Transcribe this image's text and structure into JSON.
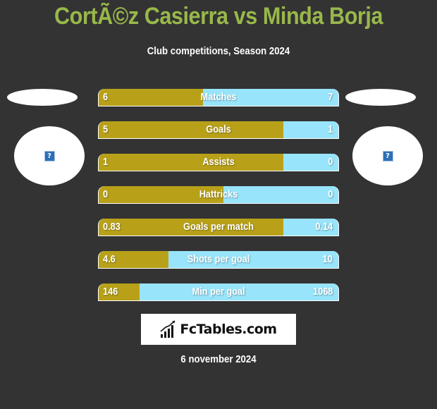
{
  "header": {
    "title": "CortÃ©z Casierra vs Minda Borja",
    "subtitle": "Club competitions, Season 2024"
  },
  "players": {
    "left": {
      "avatar_icon": "broken-image-icon",
      "avatar_glyph": "?"
    },
    "right": {
      "avatar_icon": "broken-image-icon",
      "avatar_glyph": "?"
    }
  },
  "colors": {
    "left_bar": "#b8a119",
    "right_bar": "#98e4fb",
    "title": "#98b84a",
    "background": "#333333"
  },
  "stats": [
    {
      "label": "Matches",
      "left": "6",
      "right": "7",
      "left_share": 0.435
    },
    {
      "label": "Goals",
      "left": "5",
      "right": "1",
      "left_share": 0.77
    },
    {
      "label": "Assists",
      "left": "1",
      "right": "0",
      "left_share": 0.77
    },
    {
      "label": "Hattricks",
      "left": "0",
      "right": "0",
      "left_share": 0.52
    },
    {
      "label": "Goals per match",
      "left": "0.83",
      "right": "0.14",
      "left_share": 0.77
    },
    {
      "label": "Shots per goal",
      "left": "4.6",
      "right": "10",
      "left_share": 0.29
    },
    {
      "label": "Min per goal",
      "left": "146",
      "right": "1068",
      "left_share": 0.17
    }
  ],
  "logo": {
    "text": "FcTables.com",
    "icon": "bar-chart-icon"
  },
  "footer": {
    "date": "6 november 2024"
  }
}
